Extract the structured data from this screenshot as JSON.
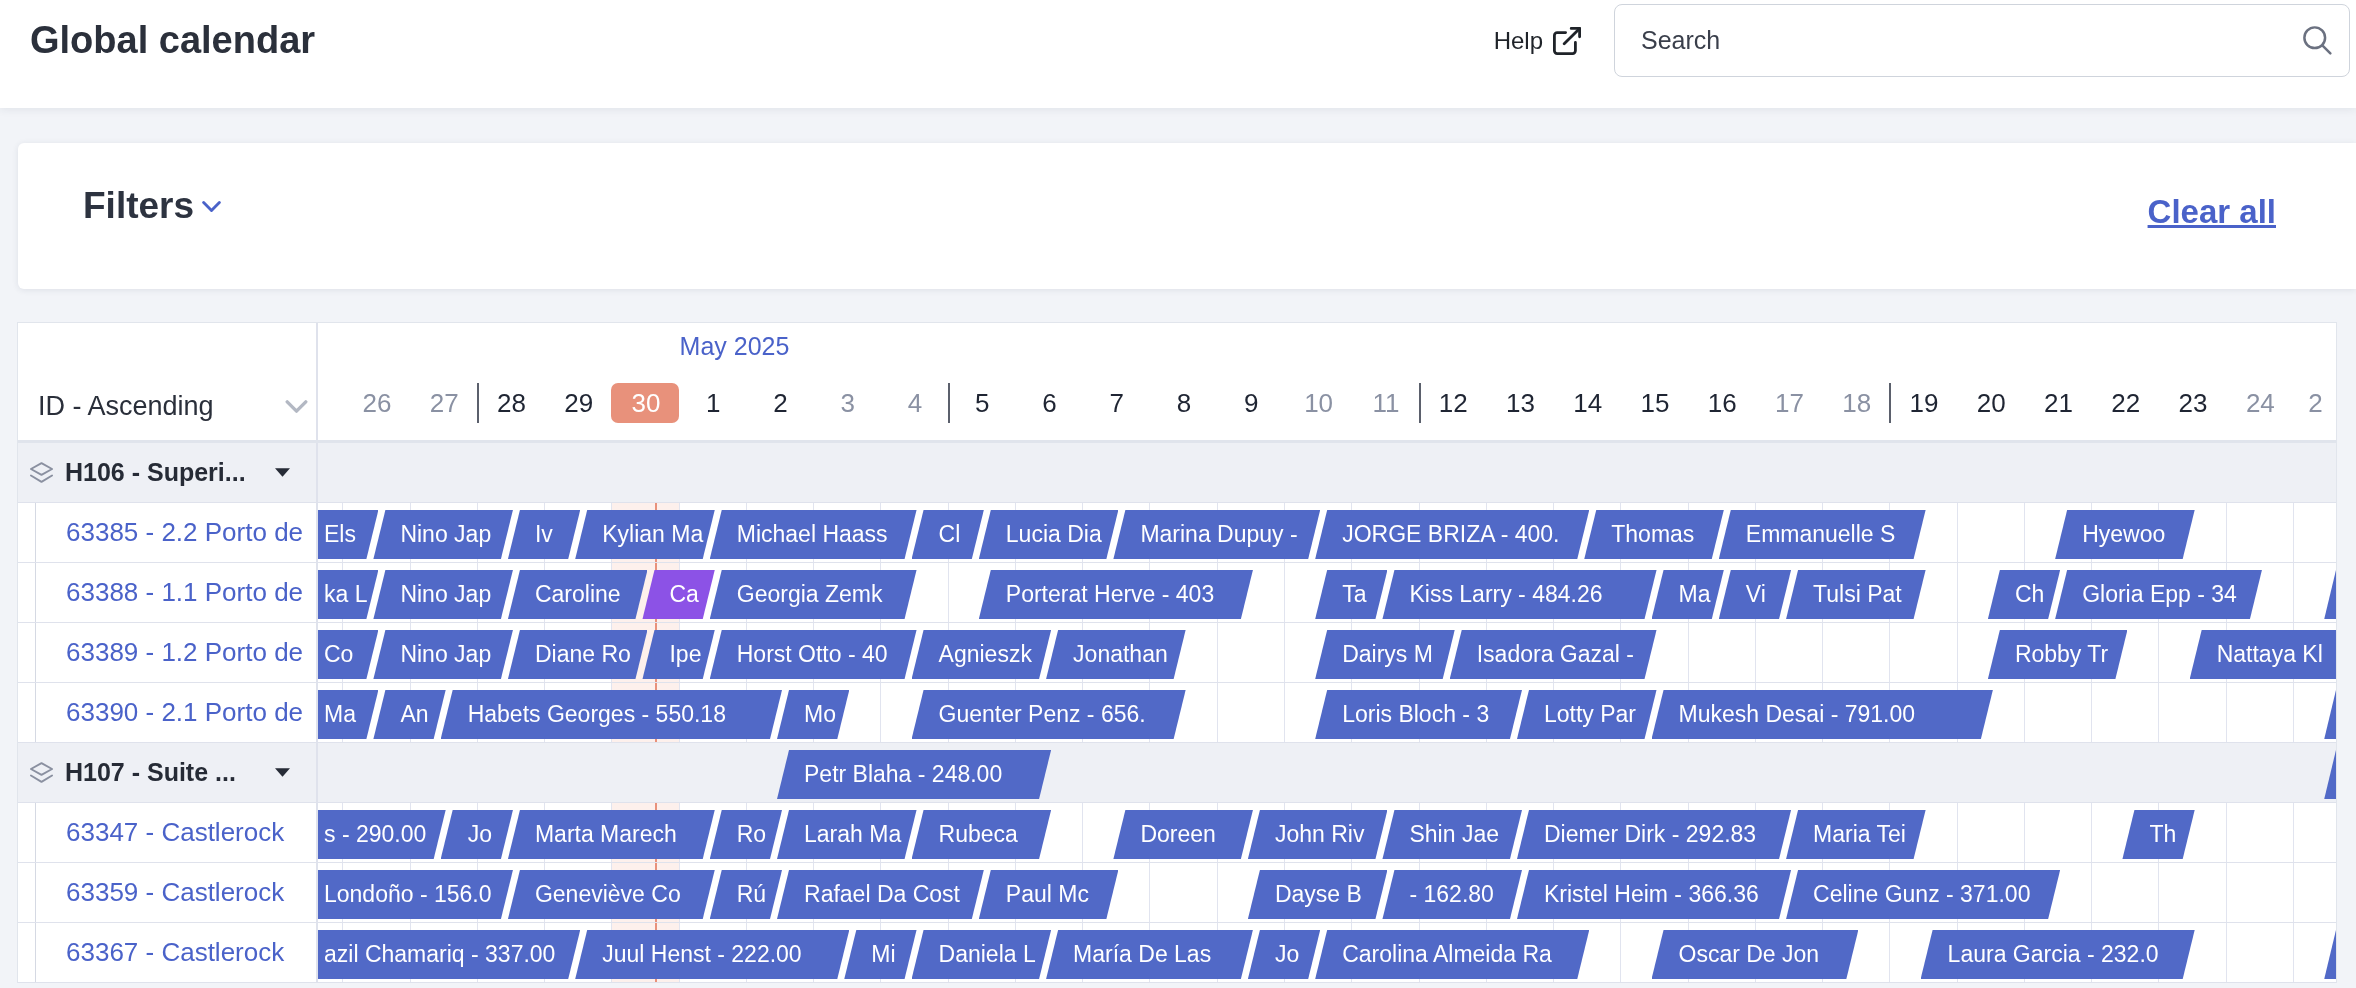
{
  "header": {
    "title": "Global calendar",
    "help": "Help",
    "search": {
      "placeholder": "Search"
    }
  },
  "filters": {
    "title": "Filters",
    "expanded": false,
    "clear": "Clear all"
  },
  "calendar": {
    "sort": "ID - Ascending",
    "timeline": {
      "now": {
        "level": 0.67
      },
      "days": [
        {
          "label": "26",
          "weekend": true,
          "today": false,
          "week_start": false
        },
        {
          "label": "27",
          "weekend": true,
          "today": false,
          "week_start": false
        },
        {
          "label": "28",
          "weekend": false,
          "today": false,
          "week_start": true
        },
        {
          "label": "29",
          "weekend": false,
          "today": false,
          "week_start": false
        },
        {
          "label": "30",
          "weekend": false,
          "today": true,
          "week_start": false
        },
        {
          "label": "1",
          "month": "May 2025",
          "weekend": false,
          "today": false,
          "week_start": false
        },
        {
          "label": "2",
          "weekend": false,
          "today": false,
          "week_start": false
        },
        {
          "label": "3",
          "weekend": true,
          "today": false,
          "week_start": false
        },
        {
          "label": "4",
          "weekend": true,
          "today": false,
          "week_start": false
        },
        {
          "label": "5",
          "weekend": false,
          "today": false,
          "week_start": true
        },
        {
          "label": "6",
          "weekend": false,
          "today": false,
          "week_start": false
        },
        {
          "label": "7",
          "weekend": false,
          "today": false,
          "week_start": false
        },
        {
          "label": "8",
          "weekend": false,
          "today": false,
          "week_start": false
        },
        {
          "label": "9",
          "weekend": false,
          "today": false,
          "week_start": false
        },
        {
          "label": "10",
          "weekend": true,
          "today": false,
          "week_start": false
        },
        {
          "label": "11",
          "weekend": true,
          "today": false,
          "week_start": false
        },
        {
          "label": "12",
          "weekend": false,
          "today": false,
          "week_start": true
        },
        {
          "label": "13",
          "weekend": false,
          "today": false,
          "week_start": false
        },
        {
          "label": "14",
          "weekend": false,
          "today": false,
          "week_start": false
        },
        {
          "label": "15",
          "weekend": false,
          "today": false,
          "week_start": false
        },
        {
          "label": "16",
          "weekend": false,
          "today": false,
          "week_start": false
        },
        {
          "label": "17",
          "weekend": true,
          "today": false,
          "week_start": false
        },
        {
          "label": "18",
          "weekend": true,
          "today": false,
          "week_start": false
        },
        {
          "label": "19",
          "weekend": false,
          "today": false,
          "week_start": true
        },
        {
          "label": "20",
          "weekend": false,
          "today": false,
          "week_start": false
        },
        {
          "label": "21",
          "weekend": false,
          "today": false,
          "week_start": false
        },
        {
          "label": "22",
          "weekend": false,
          "today": false,
          "week_start": false
        },
        {
          "label": "23",
          "weekend": false,
          "today": false,
          "week_start": false
        },
        {
          "label": "24",
          "weekend": true,
          "today": false,
          "week_start": false
        },
        {
          "label": "2",
          "weekend": true,
          "today": false,
          "week_start": false
        }
      ]
    },
    "groups": [
      {
        "name": "H106 - Superi...",
        "expanded": true,
        "units": [
          {
            "name": "63385 - 2.2 Porto de",
            "nights": [
              {
                "kind": "start",
                "label": "Els",
                "color": "#5169c7"
              },
              {
                "kind": "start",
                "label": "Nino Jap",
                "color": "#5169c7"
              },
              {
                "kind": "stay"
              },
              {
                "kind": "start",
                "label": "Iv",
                "color": "#5169c7"
              },
              {
                "kind": "start",
                "label": "Kylian Ma",
                "color": "#5169c7"
              },
              {
                "kind": "stay"
              },
              {
                "kind": "start",
                "label": "Michael Haass",
                "color": "#5169c7"
              },
              {
                "kind": "stay"
              },
              {
                "kind": "stay"
              },
              {
                "kind": "start",
                "label": "Cl",
                "color": "#5169c7"
              },
              {
                "kind": "start",
                "label": "Lucia Dia",
                "color": "#5169c7"
              },
              {
                "kind": "stay"
              },
              {
                "kind": "start",
                "label": "Marina Dupuy -",
                "color": "#5169c7"
              },
              {
                "kind": "stay"
              },
              {
                "kind": "stay"
              },
              {
                "kind": "start",
                "label": "JORGE BRIZA - 400.",
                "color": "#5169c7"
              },
              {
                "kind": "stay"
              },
              {
                "kind": "stay"
              },
              {
                "kind": "stay"
              },
              {
                "kind": "start",
                "label": "Thomas",
                "color": "#5169c7"
              },
              {
                "kind": "stay"
              },
              {
                "kind": "start",
                "label": "Emmanuelle S",
                "color": "#5169c7"
              },
              {
                "kind": "stay"
              },
              {
                "kind": "stay"
              },
              {
                "kind": "free"
              },
              {
                "kind": "free"
              },
              {
                "kind": "start",
                "label": "Hyewoo",
                "color": "#5169c7"
              },
              {
                "kind": "stay"
              }
            ]
          },
          {
            "name": "63388 - 1.1 Porto de",
            "nights": [
              {
                "kind": "start",
                "label": "ka L",
                "color": "#5169c7"
              },
              {
                "kind": "start",
                "label": "Nino Jap",
                "color": "#5169c7"
              },
              {
                "kind": "stay"
              },
              {
                "kind": "start",
                "label": "Caroline",
                "color": "#5169c7"
              },
              {
                "kind": "stay"
              },
              {
                "kind": "start",
                "label": "Ca",
                "color": "#8c52e6"
              },
              {
                "kind": "start",
                "label": "Georgia Zemk",
                "color": "#5169c7"
              },
              {
                "kind": "stay"
              },
              {
                "kind": "stay"
              },
              {
                "kind": "free"
              },
              {
                "kind": "start",
                "label": "Porterat Herve - 403",
                "color": "#5169c7"
              },
              {
                "kind": "stay"
              },
              {
                "kind": "stay"
              },
              {
                "kind": "stay"
              },
              {
                "kind": "free"
              },
              {
                "kind": "start",
                "label": "Ta",
                "color": "#5169c7"
              },
              {
                "kind": "start",
                "label": "Kiss Larry - 484.26",
                "color": "#5169c7"
              },
              {
                "kind": "stay"
              },
              {
                "kind": "stay"
              },
              {
                "kind": "stay"
              },
              {
                "kind": "start",
                "label": "Ma",
                "color": "#5169c7"
              },
              {
                "kind": "start",
                "label": "Vi",
                "color": "#5169c7"
              },
              {
                "kind": "start",
                "label": "Tulsi Pat",
                "color": "#5169c7"
              },
              {
                "kind": "stay"
              },
              {
                "kind": "free"
              },
              {
                "kind": "start",
                "label": "Ch",
                "color": "#5169c7"
              },
              {
                "kind": "start",
                "label": "Gloria Epp - 34",
                "color": "#5169c7"
              },
              {
                "kind": "stay"
              },
              {
                "kind": "stay"
              },
              {
                "kind": "free"
              },
              {
                "kind": "start",
                "color": "#5169c7"
              }
            ]
          },
          {
            "name": "63389 - 1.2 Porto de",
            "nights": [
              {
                "kind": "start",
                "label": "Co",
                "color": "#5169c7"
              },
              {
                "kind": "start",
                "label": "Nino Jap",
                "color": "#5169c7"
              },
              {
                "kind": "stay"
              },
              {
                "kind": "start",
                "label": "Diane Ro",
                "color": "#5169c7"
              },
              {
                "kind": "stay"
              },
              {
                "kind": "start",
                "label": "Ipe",
                "color": "#5169c7"
              },
              {
                "kind": "start",
                "label": "Horst Otto - 40",
                "color": "#5169c7"
              },
              {
                "kind": "stay"
              },
              {
                "kind": "stay"
              },
              {
                "kind": "start",
                "label": "Agnieszk",
                "color": "#5169c7"
              },
              {
                "kind": "stay"
              },
              {
                "kind": "start",
                "label": "Jonathan",
                "color": "#5169c7"
              },
              {
                "kind": "stay"
              },
              {
                "kind": "free"
              },
              {
                "kind": "free"
              },
              {
                "kind": "start",
                "label": "Dairys M",
                "color": "#5169c7"
              },
              {
                "kind": "stay"
              },
              {
                "kind": "start",
                "label": "Isadora Gazal -",
                "color": "#5169c7"
              },
              {
                "kind": "stay"
              },
              {
                "kind": "stay"
              },
              {
                "kind": "free"
              },
              {
                "kind": "free"
              },
              {
                "kind": "free"
              },
              {
                "kind": "free"
              },
              {
                "kind": "free"
              },
              {
                "kind": "start",
                "label": "Robby Tr",
                "color": "#5169c7"
              },
              {
                "kind": "stay"
              },
              {
                "kind": "free"
              },
              {
                "kind": "start",
                "label": "Nattaya Kl",
                "color": "#5169c7"
              },
              {
                "kind": "stay"
              },
              {
                "kind": "stay"
              }
            ]
          },
          {
            "name": "63390 - 2.1 Porto de",
            "nights": [
              {
                "kind": "start",
                "label": "Ma",
                "color": "#5169c7"
              },
              {
                "kind": "start",
                "label": "An",
                "color": "#5169c7"
              },
              {
                "kind": "start",
                "label": "Habets Georges - 550.18",
                "color": "#5169c7"
              },
              {
                "kind": "stay"
              },
              {
                "kind": "stay"
              },
              {
                "kind": "stay"
              },
              {
                "kind": "stay"
              },
              {
                "kind": "start",
                "label": "Mo",
                "color": "#5169c7"
              },
              {
                "kind": "free"
              },
              {
                "kind": "start",
                "label": "Guenter Penz - 656.",
                "color": "#5169c7"
              },
              {
                "kind": "stay"
              },
              {
                "kind": "stay"
              },
              {
                "kind": "stay"
              },
              {
                "kind": "free"
              },
              {
                "kind": "free"
              },
              {
                "kind": "start",
                "label": "Loris Bloch - 3",
                "color": "#5169c7"
              },
              {
                "kind": "stay"
              },
              {
                "kind": "stay"
              },
              {
                "kind": "start",
                "label": "Lotty Par",
                "color": "#5169c7"
              },
              {
                "kind": "stay"
              },
              {
                "kind": "start",
                "label": "Mukesh Desai - 791.00",
                "color": "#5169c7"
              },
              {
                "kind": "stay"
              },
              {
                "kind": "stay"
              },
              {
                "kind": "stay"
              },
              {
                "kind": "stay"
              },
              {
                "kind": "free"
              },
              {
                "kind": "free"
              },
              {
                "kind": "free"
              },
              {
                "kind": "free"
              },
              {
                "kind": "free"
              },
              {
                "kind": "start",
                "color": "#5169c7"
              }
            ]
          }
        ]
      },
      {
        "name": "H107 - Suite ...",
        "expanded": true,
        "nights": [
          {
            "kind": "free"
          },
          {
            "kind": "free"
          },
          {
            "kind": "free"
          },
          {
            "kind": "free"
          },
          {
            "kind": "free"
          },
          {
            "kind": "free"
          },
          {
            "kind": "free"
          },
          {
            "kind": "start",
            "label": "Petr Blaha - 248.00",
            "color": "#5169c7"
          },
          {
            "kind": "stay"
          },
          {
            "kind": "stay"
          },
          {
            "kind": "stay"
          },
          {
            "kind": "free"
          },
          {
            "kind": "free"
          },
          {
            "kind": "free"
          },
          {
            "kind": "free"
          },
          {
            "kind": "free"
          },
          {
            "kind": "free"
          },
          {
            "kind": "free"
          },
          {
            "kind": "free"
          },
          {
            "kind": "free"
          },
          {
            "kind": "free"
          },
          {
            "kind": "free"
          },
          {
            "kind": "free"
          },
          {
            "kind": "free"
          },
          {
            "kind": "free"
          },
          {
            "kind": "free"
          },
          {
            "kind": "free"
          },
          {
            "kind": "free"
          },
          {
            "kind": "free"
          },
          {
            "kind": "free"
          },
          {
            "kind": "start",
            "color": "#5169c7"
          }
        ],
        "units": [
          {
            "name": "63347 - Castlerock",
            "nights": [
              {
                "kind": "start",
                "label": "s - 290.00",
                "color": "#5169c7"
              },
              {
                "kind": "stay"
              },
              {
                "kind": "start",
                "label": "Jo",
                "color": "#5169c7"
              },
              {
                "kind": "start",
                "label": "Marta Marech",
                "color": "#5169c7"
              },
              {
                "kind": "stay"
              },
              {
                "kind": "stay"
              },
              {
                "kind": "start",
                "label": "Ro",
                "color": "#5169c7"
              },
              {
                "kind": "start",
                "label": "Larah Ma",
                "color": "#5169c7"
              },
              {
                "kind": "stay"
              },
              {
                "kind": "start",
                "label": "Rubeca",
                "color": "#5169c7"
              },
              {
                "kind": "stay"
              },
              {
                "kind": "free"
              },
              {
                "kind": "start",
                "label": "Doreen",
                "color": "#5169c7"
              },
              {
                "kind": "stay"
              },
              {
                "kind": "start",
                "label": "John Riv",
                "color": "#5169c7"
              },
              {
                "kind": "stay"
              },
              {
                "kind": "start",
                "label": "Shin Jae",
                "color": "#5169c7"
              },
              {
                "kind": "stay"
              },
              {
                "kind": "start",
                "label": "Diemer Dirk - 292.83",
                "color": "#5169c7"
              },
              {
                "kind": "stay"
              },
              {
                "kind": "stay"
              },
              {
                "kind": "stay"
              },
              {
                "kind": "start",
                "label": "Maria Tei",
                "color": "#5169c7"
              },
              {
                "kind": "stay"
              },
              {
                "kind": "free"
              },
              {
                "kind": "free"
              },
              {
                "kind": "free"
              },
              {
                "kind": "start",
                "label": "Th",
                "color": "#5169c7"
              }
            ]
          },
          {
            "name": "63359 - Castlerock",
            "nights": [
              {
                "kind": "start",
                "label": "Londoño - 156.0",
                "color": "#5169c7"
              },
              {
                "kind": "stay"
              },
              {
                "kind": "stay"
              },
              {
                "kind": "start",
                "label": "Geneviève Co",
                "color": "#5169c7"
              },
              {
                "kind": "stay"
              },
              {
                "kind": "stay"
              },
              {
                "kind": "start",
                "label": "Rú",
                "color": "#5169c7"
              },
              {
                "kind": "start",
                "label": "Rafael Da Cost",
                "color": "#5169c7"
              },
              {
                "kind": "stay"
              },
              {
                "kind": "stay"
              },
              {
                "kind": "start",
                "label": "Paul Mc",
                "color": "#5169c7"
              },
              {
                "kind": "stay"
              },
              {
                "kind": "free"
              },
              {
                "kind": "free"
              },
              {
                "kind": "start",
                "label": "Dayse B",
                "color": "#5169c7"
              },
              {
                "kind": "stay"
              },
              {
                "kind": "start",
                "label": "- 162.80",
                "color": "#5169c7"
              },
              {
                "kind": "stay"
              },
              {
                "kind": "start",
                "label": "Kristel Heim - 366.36",
                "color": "#5169c7"
              },
              {
                "kind": "stay"
              },
              {
                "kind": "stay"
              },
              {
                "kind": "stay"
              },
              {
                "kind": "start",
                "label": "Celine Gunz - 371.00",
                "color": "#5169c7"
              },
              {
                "kind": "stay"
              },
              {
                "kind": "stay"
              },
              {
                "kind": "stay"
              }
            ]
          },
          {
            "name": "63367 - Castlerock",
            "nights": [
              {
                "kind": "start",
                "label": "azil Chamariq - 337.00",
                "color": "#5169c7"
              },
              {
                "kind": "stay"
              },
              {
                "kind": "stay"
              },
              {
                "kind": "stay"
              },
              {
                "kind": "start",
                "label": "Juul Henst - 222.00",
                "color": "#5169c7"
              },
              {
                "kind": "stay"
              },
              {
                "kind": "stay"
              },
              {
                "kind": "stay"
              },
              {
                "kind": "start",
                "label": "Mi",
                "color": "#5169c7"
              },
              {
                "kind": "start",
                "label": "Daniela L",
                "color": "#5169c7"
              },
              {
                "kind": "stay"
              },
              {
                "kind": "start",
                "label": "María De Las",
                "color": "#5169c7"
              },
              {
                "kind": "stay"
              },
              {
                "kind": "stay"
              },
              {
                "kind": "start",
                "label": "Jo",
                "color": "#5169c7"
              },
              {
                "kind": "start",
                "label": "Carolina Almeida Ra",
                "color": "#5169c7"
              },
              {
                "kind": "stay"
              },
              {
                "kind": "stay"
              },
              {
                "kind": "stay"
              },
              {
                "kind": "free"
              },
              {
                "kind": "start",
                "label": "Oscar De Jon",
                "color": "#5169c7"
              },
              {
                "kind": "stay"
              },
              {
                "kind": "stay"
              },
              {
                "kind": "free"
              },
              {
                "kind": "start",
                "label": "Laura Garcia - 232.0",
                "color": "#5169c7"
              },
              {
                "kind": "stay"
              },
              {
                "kind": "stay"
              },
              {
                "kind": "stay"
              },
              {
                "kind": "free"
              },
              {
                "kind": "free"
              },
              {
                "kind": "start",
                "color": "#5169c7"
              }
            ]
          }
        ]
      }
    ]
  }
}
